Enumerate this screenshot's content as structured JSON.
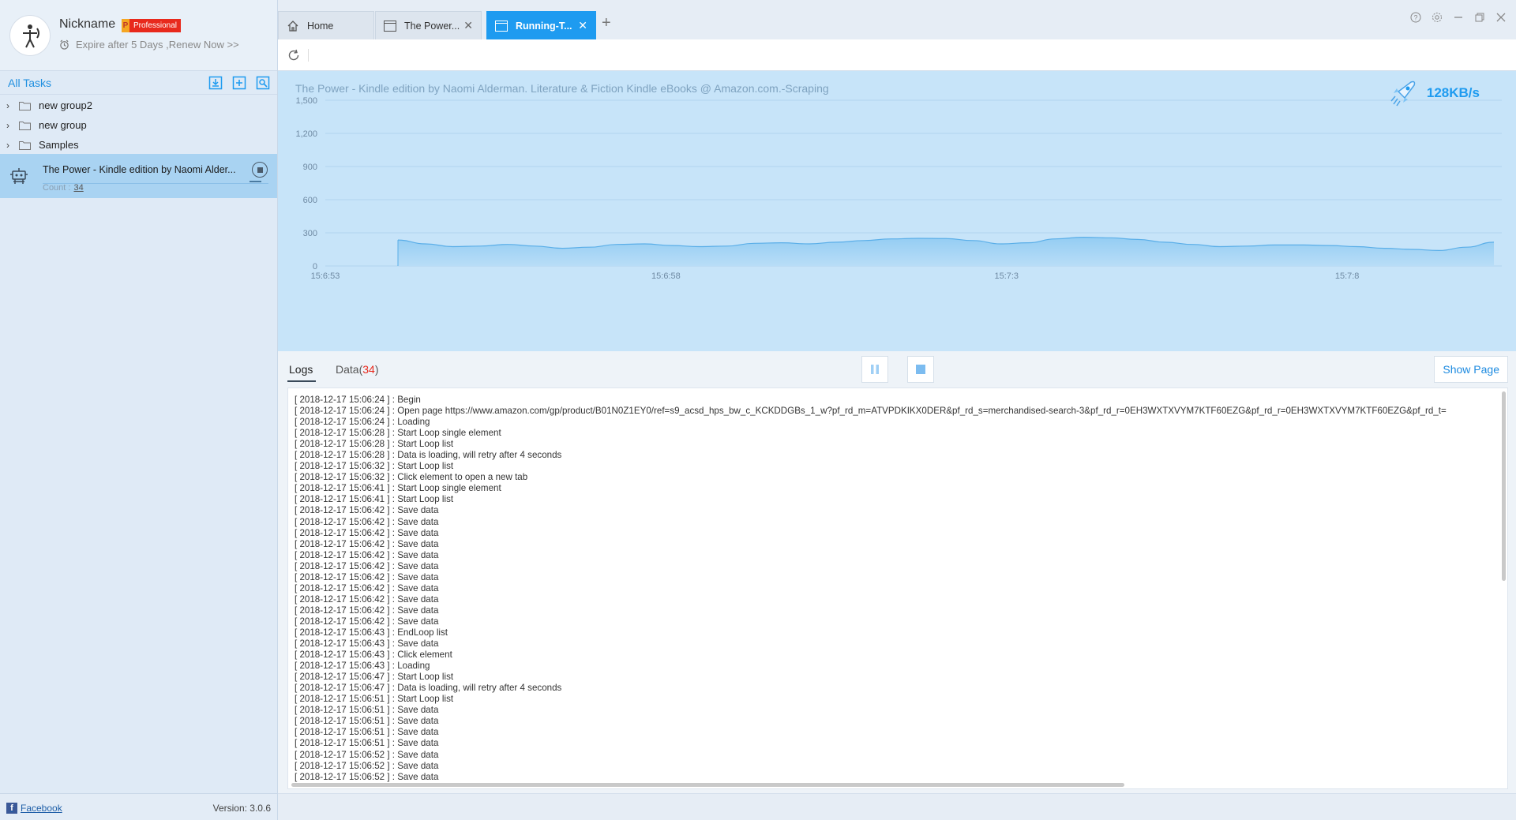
{
  "profile": {
    "nickname": "Nickname",
    "badge_letter": "P",
    "badge_text": "Professional",
    "expire_text": "Expire after 5 Days ,Renew Now >>"
  },
  "sidebar": {
    "tasks_title": "All Tasks",
    "groups": [
      {
        "label": "new group2"
      },
      {
        "label": "new group"
      },
      {
        "label": "Samples"
      }
    ],
    "task": {
      "name": "The Power - Kindle edition by Naomi Alder...",
      "count_label": "Count :",
      "count_value": "34"
    },
    "footer": {
      "facebook": "Facebook",
      "version": "Version: 3.0.6"
    }
  },
  "tabs": [
    {
      "label": "Home",
      "icon": "home-icon"
    },
    {
      "label": "The Power...",
      "icon": "page-icon"
    },
    {
      "label": "Running-T...",
      "icon": "page-icon"
    }
  ],
  "chart_data": {
    "type": "area",
    "title": "The Power - Kindle edition by Naomi Alderman. Literature & Fiction Kindle eBooks @ Amazon.com.-Scraping",
    "speed": "128KB/s",
    "xlabel": "",
    "ylabel": "",
    "ylim": [
      0,
      1500
    ],
    "yticks": [
      "1,500",
      "1,200",
      "900",
      "600",
      "300",
      "0"
    ],
    "xticks": [
      "15:6:53",
      "15:6:58",
      "15:7:3",
      "15:7:8"
    ],
    "grid": true,
    "x": [
      0,
      1,
      2,
      3,
      4,
      5,
      6,
      7,
      8,
      9,
      10,
      11,
      12,
      13,
      14,
      15,
      16,
      17,
      18,
      19,
      20,
      21,
      22,
      23,
      24,
      25,
      26,
      27,
      28,
      29,
      30,
      31,
      32,
      33,
      34,
      35,
      36,
      37,
      38,
      39,
      40
    ],
    "values": [
      235,
      200,
      175,
      180,
      195,
      180,
      160,
      170,
      195,
      200,
      185,
      175,
      180,
      205,
      210,
      200,
      215,
      230,
      245,
      250,
      248,
      230,
      200,
      210,
      245,
      260,
      255,
      240,
      215,
      195,
      175,
      180,
      190,
      190,
      185,
      175,
      160,
      150,
      140,
      170,
      215
    ]
  },
  "logs": {
    "tab_logs": "Logs",
    "tab_data_label": "Data(",
    "tab_data_count": "34",
    "tab_data_close": ")",
    "show_page": "Show Page",
    "lines": [
      "[ 2018-12-17 15:06:24 ] : Begin",
      "[ 2018-12-17 15:06:24 ] : Open page https://www.amazon.com/gp/product/B01N0Z1EY0/ref=s9_acsd_hps_bw_c_KCKDDGBs_1_w?pf_rd_m=ATVPDKIKX0DER&pf_rd_s=merchandised-search-3&pf_rd_r=0EH3WXTXVYM7KTF60EZG&pf_rd_r=0EH3WXTXVYM7KTF60EZG&pf_rd_t=",
      "[ 2018-12-17 15:06:24 ] : Loading",
      "[ 2018-12-17 15:06:28 ] : Start Loop single element",
      "[ 2018-12-17 15:06:28 ] : Start Loop list",
      "[ 2018-12-17 15:06:28 ] : Data is loading, will retry after 4 seconds",
      "[ 2018-12-17 15:06:32 ] : Start Loop list",
      "[ 2018-12-17 15:06:32 ] : Click element to open a new tab",
      "[ 2018-12-17 15:06:41 ] : Start Loop single element",
      "[ 2018-12-17 15:06:41 ] : Start Loop list",
      "[ 2018-12-17 15:06:42 ] : Save data",
      "[ 2018-12-17 15:06:42 ] : Save data",
      "[ 2018-12-17 15:06:42 ] : Save data",
      "[ 2018-12-17 15:06:42 ] : Save data",
      "[ 2018-12-17 15:06:42 ] : Save data",
      "[ 2018-12-17 15:06:42 ] : Save data",
      "[ 2018-12-17 15:06:42 ] : Save data",
      "[ 2018-12-17 15:06:42 ] : Save data",
      "[ 2018-12-17 15:06:42 ] : Save data",
      "[ 2018-12-17 15:06:42 ] : Save data",
      "[ 2018-12-17 15:06:42 ] : Save data",
      "[ 2018-12-17 15:06:43 ] : EndLoop list",
      "[ 2018-12-17 15:06:43 ] : Save data",
      "[ 2018-12-17 15:06:43 ] : Click element",
      "[ 2018-12-17 15:06:43 ] : Loading",
      "[ 2018-12-17 15:06:47 ] : Start Loop list",
      "[ 2018-12-17 15:06:47 ] : Data is loading, will retry after 4 seconds",
      "[ 2018-12-17 15:06:51 ] : Start Loop list",
      "[ 2018-12-17 15:06:51 ] : Save data",
      "[ 2018-12-17 15:06:51 ] : Save data",
      "[ 2018-12-17 15:06:51 ] : Save data",
      "[ 2018-12-17 15:06:51 ] : Save data",
      "[ 2018-12-17 15:06:52 ] : Save data",
      "[ 2018-12-17 15:06:52 ] : Save data",
      "[ 2018-12-17 15:06:52 ] : Save data"
    ]
  },
  "colors": {
    "accent": "#1e9bf0",
    "chart_bg": "#c7e4f9",
    "area_fill": "#94cdf3",
    "area_stroke": "#5aaee8",
    "badge_red": "#e8291c"
  }
}
